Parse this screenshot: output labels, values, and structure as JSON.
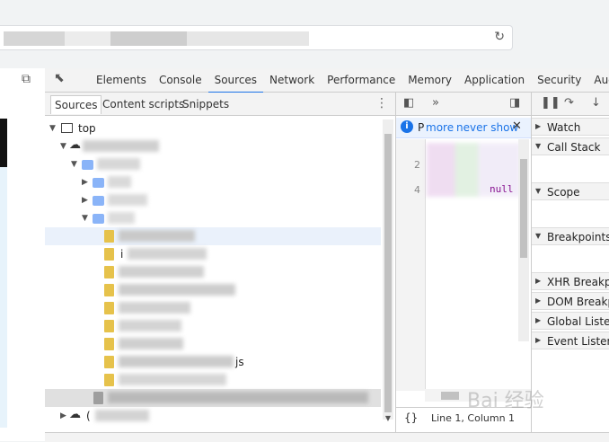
{
  "devtools": {
    "tabs": [
      "Elements",
      "Console",
      "Sources",
      "Network",
      "Performance",
      "Memory",
      "Application",
      "Security",
      "Audit"
    ],
    "active_tab": "Sources",
    "navigator_tabs": [
      "Sources",
      "Content scripts",
      "Snippets"
    ],
    "active_navigator_tab": "Sources"
  },
  "tree": {
    "top_label": "top",
    "partial_label_1": "i",
    "partial_label_2": "js",
    "partial_label_3": "( "
  },
  "editor": {
    "infobar_prefix": "P",
    "infobar_more": "more",
    "infobar_never_show": "never show",
    "line_numbers": [
      "2",
      "4"
    ],
    "code_snippet": "null",
    "status": "Line 1, Column 1",
    "pretty_print": "{}"
  },
  "debugger": {
    "sections": [
      "Watch",
      "Call Stack",
      "Scope",
      "Breakpoints",
      "XHR Breakpo",
      "DOM Breakp",
      "Global Listen",
      "Event Listene"
    ]
  },
  "watermark": "Bai 经验",
  "colors": {
    "accent": "#1a73e8",
    "file": "#e6c24b",
    "folder": "#8ab4f8",
    "selected_row": "#eaf1fb"
  }
}
